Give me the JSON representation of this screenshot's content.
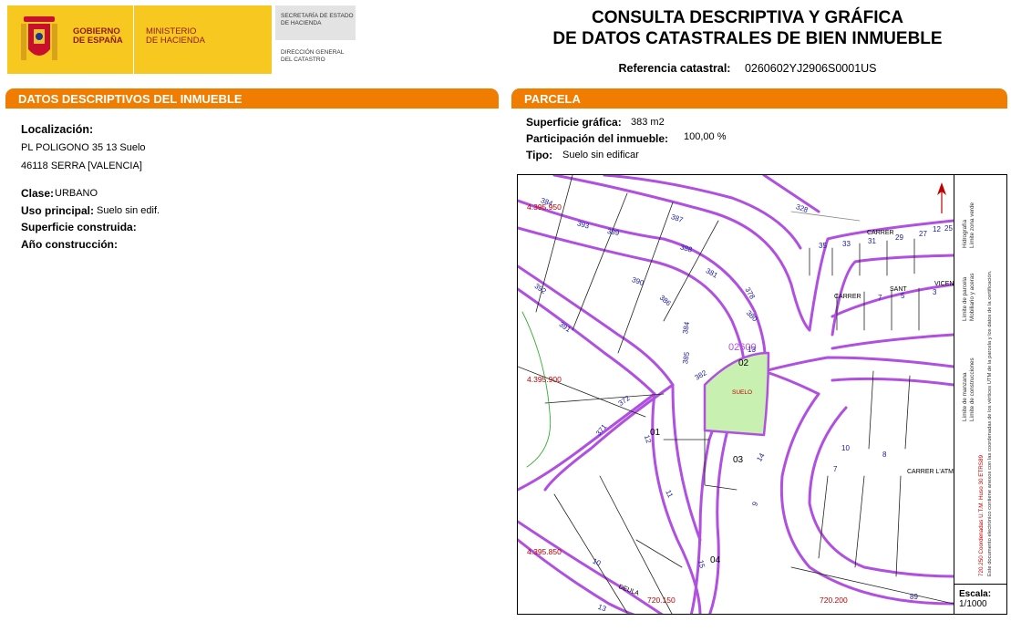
{
  "header": {
    "gobierno": [
      "GOBIERNO",
      "DE ESPAÑA"
    ],
    "ministerio": [
      "MINISTERIO",
      "DE HACIENDA"
    ],
    "secretaria": [
      "SECRETARÍA DE ESTADO",
      "DE HACIENDA"
    ],
    "direccion": [
      "DIRECCIÓN GENERAL",
      "DEL CATASTRO"
    ],
    "brand_color": "#f7c81f",
    "title_line1": "CONSULTA DESCRIPTIVA Y GRÁFICA",
    "title_line2": "DE DATOS CATASTRALES DE BIEN INMUEBLE",
    "ref_label": "Referencia catastral:",
    "ref_value": "0260602YJ2906S0001US"
  },
  "left_section": {
    "title": "DATOS DESCRIPTIVOS DEL INMUEBLE",
    "accent_color": "#f07c00",
    "localizacion_label": "Localización:",
    "address_line1": "PL POLIGONO 35 13 Suelo",
    "address_line2": "46118 SERRA [VALENCIA]",
    "clase_label": "Clase:",
    "clase_value": "URBANO",
    "uso_label": "Uso principal:",
    "uso_value": "Suelo sin edif.",
    "superficie_label": "Superficie construida:",
    "anio_label": "Año construcción:"
  },
  "right_section": {
    "title": "PARCELA",
    "superficie_label": "Superficie gráfica:",
    "superficie_value": "383 m2",
    "participacion_label": "Participación del inmueble:",
    "participacion_value": "100,00 %",
    "tipo_label": "Tipo:",
    "tipo_value": "Suelo sin edificar"
  },
  "map": {
    "road_color": "#b050e0",
    "parcel_fill": "#c8f0b0",
    "coord_color": "#c00000",
    "number_color": "#1a1aa0",
    "y_coords": [
      "4.395.950",
      "4.395.900",
      "4.395.850"
    ],
    "x_coords": [
      "720.150",
      "720.200"
    ],
    "parcel_ids": [
      "02",
      "01",
      "03",
      "04"
    ],
    "parcel_code": "02600",
    "suelo_label": "SUELO",
    "street_numbers": [
      "384",
      "393",
      "389",
      "387",
      "328",
      "35",
      "33",
      "31",
      "29",
      "27",
      "12",
      "25",
      "388",
      "381",
      "378",
      "380",
      "390",
      "386",
      "384",
      "392",
      "391",
      "13",
      "385",
      "382",
      "372",
      "371",
      "12",
      "11",
      "14",
      "10",
      "8",
      "7",
      "9",
      "10",
      "15",
      "13",
      "89",
      "5",
      "7",
      "3"
    ],
    "streets": [
      "CARRER",
      "CARRER",
      "SANT",
      "VICEN",
      "CARRER L'ATM",
      "DEULA"
    ],
    "legend": {
      "limite_manzana": "Límite de manzana",
      "limite_parcela": "Límite de parcela",
      "limite_construcciones": "Límite de construcciones",
      "mobiliario": "Mobiliario y aceras",
      "limite_zona_verde": "Límite zona verde",
      "hidrografia": "Hidrografía",
      "utm_note": "720.250 Coordenadas U.T.M. Huso 30 ETRS89",
      "doc_note": "Este documento electrónico contiene anexos con las coordenadas de los vértices UTM de la parcela y los datos de la certificación."
    },
    "escala_label": "Escala:",
    "escala_value": "1/1000"
  }
}
